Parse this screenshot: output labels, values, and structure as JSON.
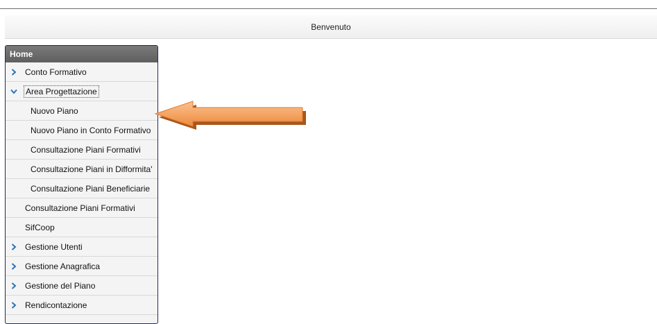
{
  "header": {
    "welcome": "Benvenuto"
  },
  "menu": {
    "title": "Home",
    "items": [
      {
        "label": "Conto Formativo",
        "icon": "chevron-right-icon"
      },
      {
        "label": "Area Progettazione",
        "icon": "chevron-down-icon"
      },
      {
        "label": "Nuovo Piano"
      },
      {
        "label": "Nuovo Piano in Conto Formativo"
      },
      {
        "label": "Consultazione Piani Formativi"
      },
      {
        "label": "Consultazione Piani in Difformita'"
      },
      {
        "label": "Consultazione Piani Beneficiarie"
      },
      {
        "label": "Consultazione Piani Formativi"
      },
      {
        "label": "SifCoop"
      },
      {
        "label": "Gestione Utenti",
        "icon": "chevron-right-icon"
      },
      {
        "label": "Gestione Anagrafica",
        "icon": "chevron-right-icon"
      },
      {
        "label": "Gestione del Piano",
        "icon": "chevron-right-icon"
      },
      {
        "label": "Rendicontazione",
        "icon": "chevron-right-icon"
      }
    ]
  },
  "colors": {
    "arrow": "#f49a55",
    "chevron": "#2a74b8",
    "menu_border": "#1f2a5a"
  }
}
